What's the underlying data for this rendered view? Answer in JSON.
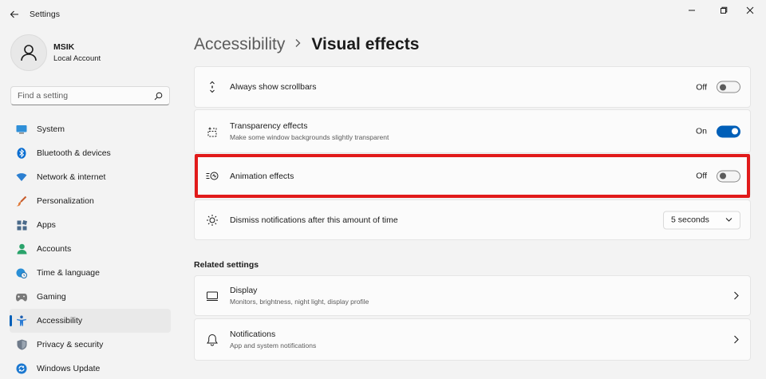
{
  "app": {
    "title": "Settings"
  },
  "profile": {
    "name": "MSIK",
    "account_type": "Local Account"
  },
  "search": {
    "placeholder": "Find a setting"
  },
  "sidebar": {
    "items": [
      {
        "label": "System",
        "icon": "system-icon",
        "active": false
      },
      {
        "label": "Bluetooth & devices",
        "icon": "bluetooth-icon",
        "active": false
      },
      {
        "label": "Network & internet",
        "icon": "wifi-icon",
        "active": false
      },
      {
        "label": "Personalization",
        "icon": "brush-icon",
        "active": false
      },
      {
        "label": "Apps",
        "icon": "apps-icon",
        "active": false
      },
      {
        "label": "Accounts",
        "icon": "accounts-icon",
        "active": false
      },
      {
        "label": "Time & language",
        "icon": "globe-clock-icon",
        "active": false
      },
      {
        "label": "Gaming",
        "icon": "gamepad-icon",
        "active": false
      },
      {
        "label": "Accessibility",
        "icon": "accessibility-icon",
        "active": true
      },
      {
        "label": "Privacy & security",
        "icon": "shield-icon",
        "active": false
      },
      {
        "label": "Windows Update",
        "icon": "update-icon",
        "active": false
      }
    ]
  },
  "breadcrumb": {
    "parent": "Accessibility",
    "current": "Visual effects"
  },
  "settings": {
    "scrollbars": {
      "title": "Always show scrollbars",
      "state": "Off",
      "on": false
    },
    "transparency": {
      "title": "Transparency effects",
      "subtitle": "Make some window backgrounds slightly transparent",
      "state": "On",
      "on": true
    },
    "animation": {
      "title": "Animation effects",
      "state": "Off",
      "on": false
    },
    "notifications_time": {
      "title": "Dismiss notifications after this amount of time",
      "value": "5 seconds"
    }
  },
  "related": {
    "heading": "Related settings",
    "display": {
      "title": "Display",
      "subtitle": "Monitors, brightness, night light, display profile"
    },
    "notifications": {
      "title": "Notifications",
      "subtitle": "App and system notifications"
    }
  },
  "colors": {
    "accent": "#005fb8",
    "highlight": "#e11a1a",
    "background": "#f3f3f3",
    "card": "#fbfbfb"
  }
}
